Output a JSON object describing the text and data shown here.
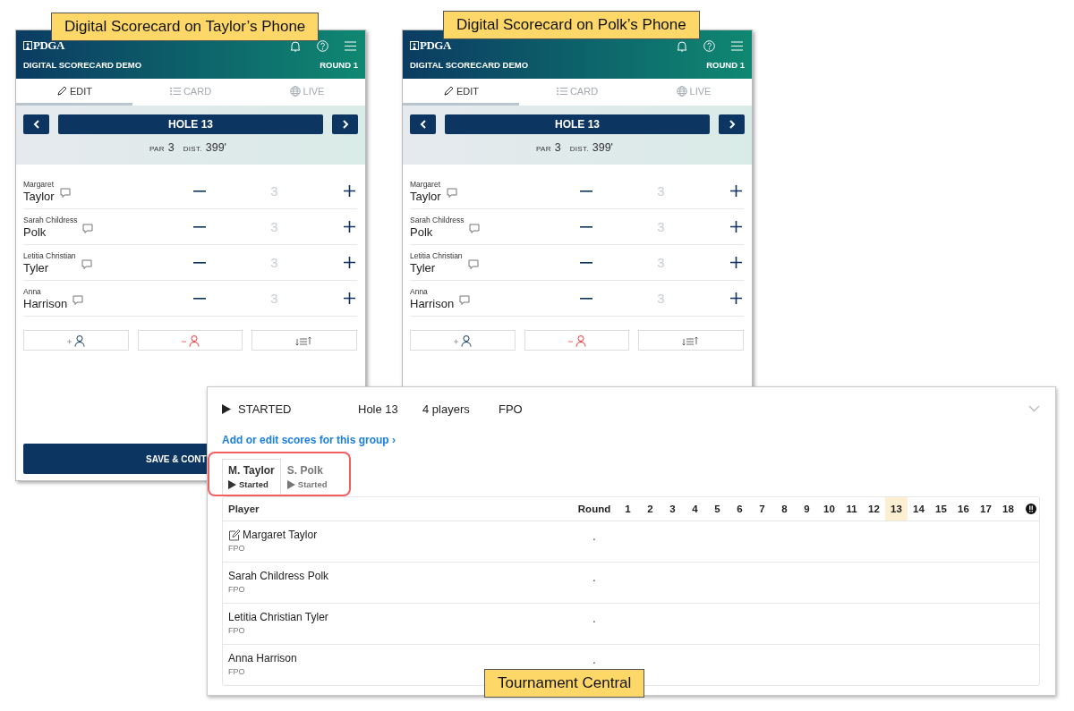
{
  "callouts": [
    {
      "text": "Digital Scorecard on Taylor’s Phone"
    },
    {
      "text": "Digital Scorecard on Polk’s Phone"
    },
    {
      "text": "Tournament Central"
    }
  ],
  "phones": [
    {
      "header": {
        "logo": "PDGA",
        "title": "DIGITAL SCORECARD DEMO",
        "round": "ROUND 1"
      },
      "tabs": [
        {
          "kind": "edit",
          "label": "EDIT",
          "selected": true
        },
        {
          "kind": "card",
          "label": "CARD",
          "selected": false
        },
        {
          "kind": "live",
          "label": "LIVE",
          "selected": false
        }
      ],
      "hole": {
        "label": "HOLE 13",
        "par_label": "PAR",
        "par": "3",
        "dist_label": "DIST.",
        "dist": "399'"
      },
      "players": [
        {
          "first": "Margaret",
          "last": "Taylor",
          "score": "3"
        },
        {
          "first": "Sarah Childress",
          "last": "Polk",
          "score": "3"
        },
        {
          "first": "Letitia Christian",
          "last": "Tyler",
          "score": "3"
        },
        {
          "first": "Anna",
          "last": "Harrison",
          "score": "3"
        }
      ],
      "save_button": "SAVE & CONT"
    },
    {
      "header": {
        "logo": "PDGA",
        "title": "DIGITAL SCORECARD DEMO",
        "round": "ROUND 1"
      },
      "tabs": [
        {
          "kind": "edit",
          "label": "EDIT",
          "selected": true
        },
        {
          "kind": "card",
          "label": "CARD",
          "selected": false
        },
        {
          "kind": "live",
          "label": "LIVE",
          "selected": false
        }
      ],
      "hole": {
        "label": "HOLE 13",
        "par_label": "PAR",
        "par": "3",
        "dist_label": "DIST.",
        "dist": "399'"
      },
      "players": [
        {
          "first": "Margaret",
          "last": "Taylor",
          "score": "3"
        },
        {
          "first": "Sarah Childress",
          "last": "Polk",
          "score": "3"
        },
        {
          "first": "Letitia Christian",
          "last": "Tyler",
          "score": "3"
        },
        {
          "first": "Anna",
          "last": "Harrison",
          "score": "3"
        }
      ]
    }
  ],
  "tournament_central": {
    "status": "STARTED",
    "hole": "Hole 13",
    "players_count": "4 players",
    "division": "FPO",
    "link": "Add or edit scores for this group ›",
    "player_tabs": [
      {
        "name": "M. Taylor",
        "status": "Started",
        "selected": true
      },
      {
        "name": "S. Polk",
        "status": "Started",
        "selected": false
      }
    ],
    "table": {
      "player_column": "Player",
      "round_column": "Round",
      "hole_columns": [
        {
          "label": "1",
          "current": false
        },
        {
          "label": "2",
          "current": false
        },
        {
          "label": "3",
          "current": false
        },
        {
          "label": "4",
          "current": false
        },
        {
          "label": "5",
          "current": false
        },
        {
          "label": "6",
          "current": false
        },
        {
          "label": "7",
          "current": false
        },
        {
          "label": "8",
          "current": false
        },
        {
          "label": "9",
          "current": false
        },
        {
          "label": "10",
          "current": false
        },
        {
          "label": "11",
          "current": false
        },
        {
          "label": "12",
          "current": false
        },
        {
          "label": "13",
          "current": true
        },
        {
          "label": "14",
          "current": false
        },
        {
          "label": "15",
          "current": false
        },
        {
          "label": "16",
          "current": false
        },
        {
          "label": "17",
          "current": false
        },
        {
          "label": "18",
          "current": false
        }
      ],
      "rows": [
        {
          "name": "Margaret Taylor",
          "division": "FPO",
          "round": ".",
          "editing": true
        },
        {
          "name": "Sarah Childress Polk",
          "division": "FPO",
          "round": ".",
          "editing": false
        },
        {
          "name": "Letitia Christian Tyler",
          "division": "FPO",
          "round": ".",
          "editing": false
        },
        {
          "name": "Anna Harrison",
          "division": "FPO",
          "round": ".",
          "editing": false
        }
      ]
    }
  }
}
